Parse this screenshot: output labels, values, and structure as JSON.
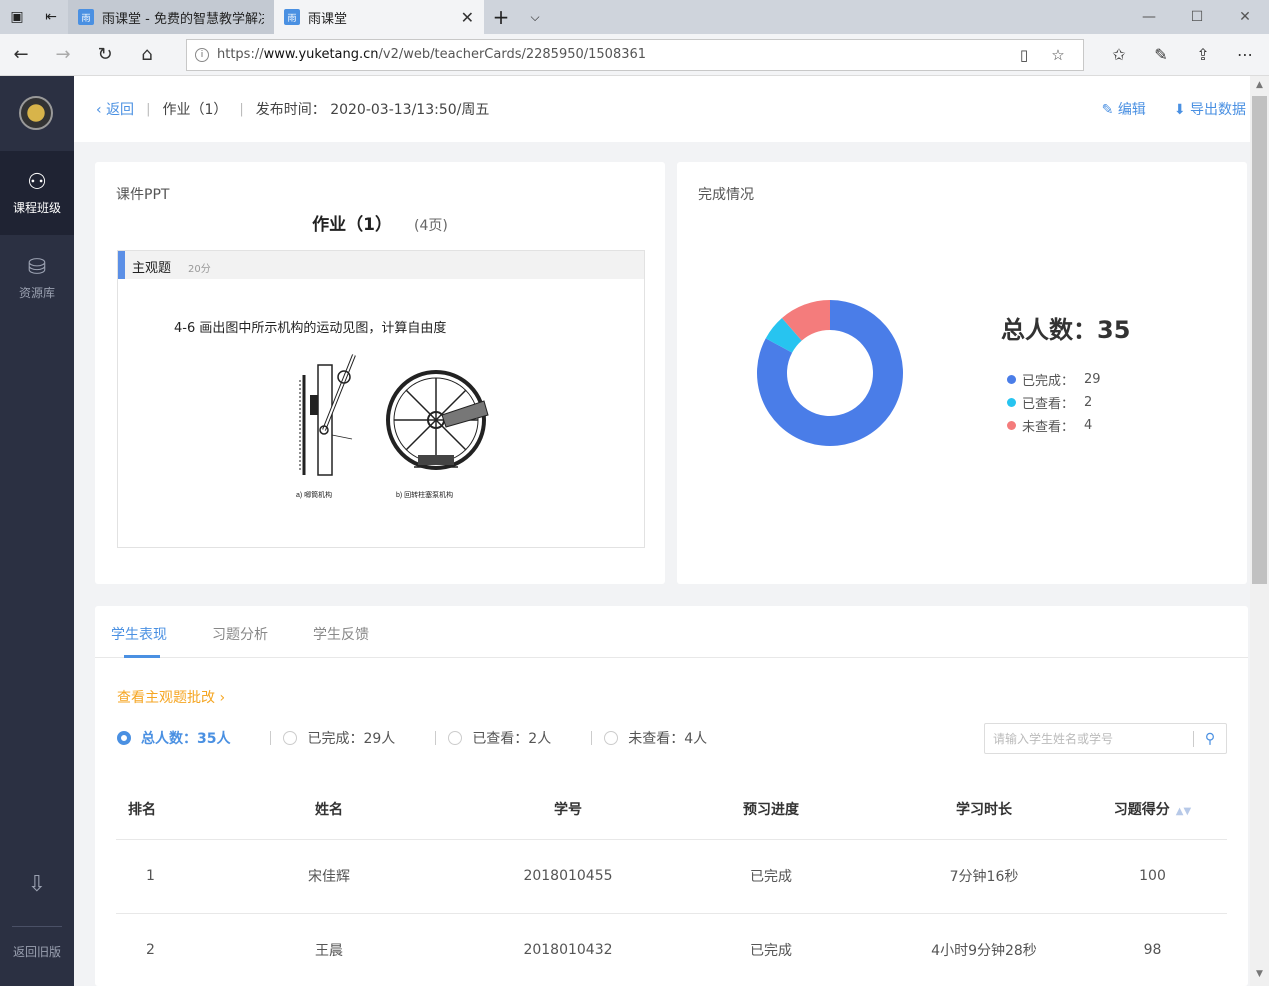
{
  "browser": {
    "tabs": [
      {
        "title": "雨课堂 - 免费的智慧教学解决",
        "active": false
      },
      {
        "title": "雨课堂",
        "active": true
      }
    ],
    "url_prefix": "https://",
    "url_domain": "www.yuketang.cn",
    "url_path": "/v2/web/teacherCards/2285950/1508361"
  },
  "sidebar": {
    "items": [
      {
        "label": "课程班级",
        "icon": "course-class-icon",
        "active": true
      },
      {
        "label": "资源库",
        "icon": "resource-library-icon",
        "active": false
      }
    ],
    "bottom_label": "返回旧版"
  },
  "header": {
    "back": "返回",
    "title": "作业（1）",
    "publish_time": "发布时间： 2020-03-13/13:50/周五",
    "edit": "编辑",
    "export": "导出数据"
  },
  "ppt_card": {
    "label": "课件PPT",
    "title": "作业（1）",
    "pages": "(4页)",
    "slide": {
      "question_type": "主观题",
      "score": "20分",
      "question_text": "4-6 画出图中所示机构的运动见图，计算自由度",
      "fig_label_a": "a) 唧筒机构",
      "fig_label_b": "b) 回转柱塞泵机构"
    }
  },
  "completion_card": {
    "label": "完成情况",
    "total": "总人数：35",
    "legend": [
      {
        "label": "已完成：",
        "value": "29",
        "color": "#4a7de8"
      },
      {
        "label": "已查看：",
        "value": "2",
        "color": "#27c4f0"
      },
      {
        "label": "未查看：",
        "value": "4",
        "color": "#f47c7c"
      }
    ]
  },
  "chart_data": {
    "type": "pie",
    "categories": [
      "已完成",
      "已查看",
      "未查看"
    ],
    "values": [
      29,
      2,
      4
    ],
    "colors": [
      "#4a7de8",
      "#27c4f0",
      "#f47c7c"
    ],
    "title": "",
    "donut": true
  },
  "students": {
    "tabs": [
      "学生表现",
      "习题分析",
      "学生反馈"
    ],
    "active_tab": 0,
    "review_link": "查看主观题批改",
    "filters": [
      {
        "label": "总人数：35人",
        "active": true
      },
      {
        "label": "已完成：29人",
        "active": false
      },
      {
        "label": "已查看：2人",
        "active": false
      },
      {
        "label": "未查看：4人",
        "active": false
      }
    ],
    "search_placeholder": "请输入学生姓名或学号",
    "columns": [
      "排名",
      "姓名",
      "学号",
      "预习进度",
      "学习时长",
      "习题得分"
    ],
    "rows": [
      [
        "1",
        "宋佳辉",
        "2018010455",
        "已完成",
        "7分钟16秒",
        "100"
      ],
      [
        "2",
        "王晨",
        "2018010432",
        "已完成",
        "4小时9分钟28秒",
        "98"
      ]
    ]
  }
}
